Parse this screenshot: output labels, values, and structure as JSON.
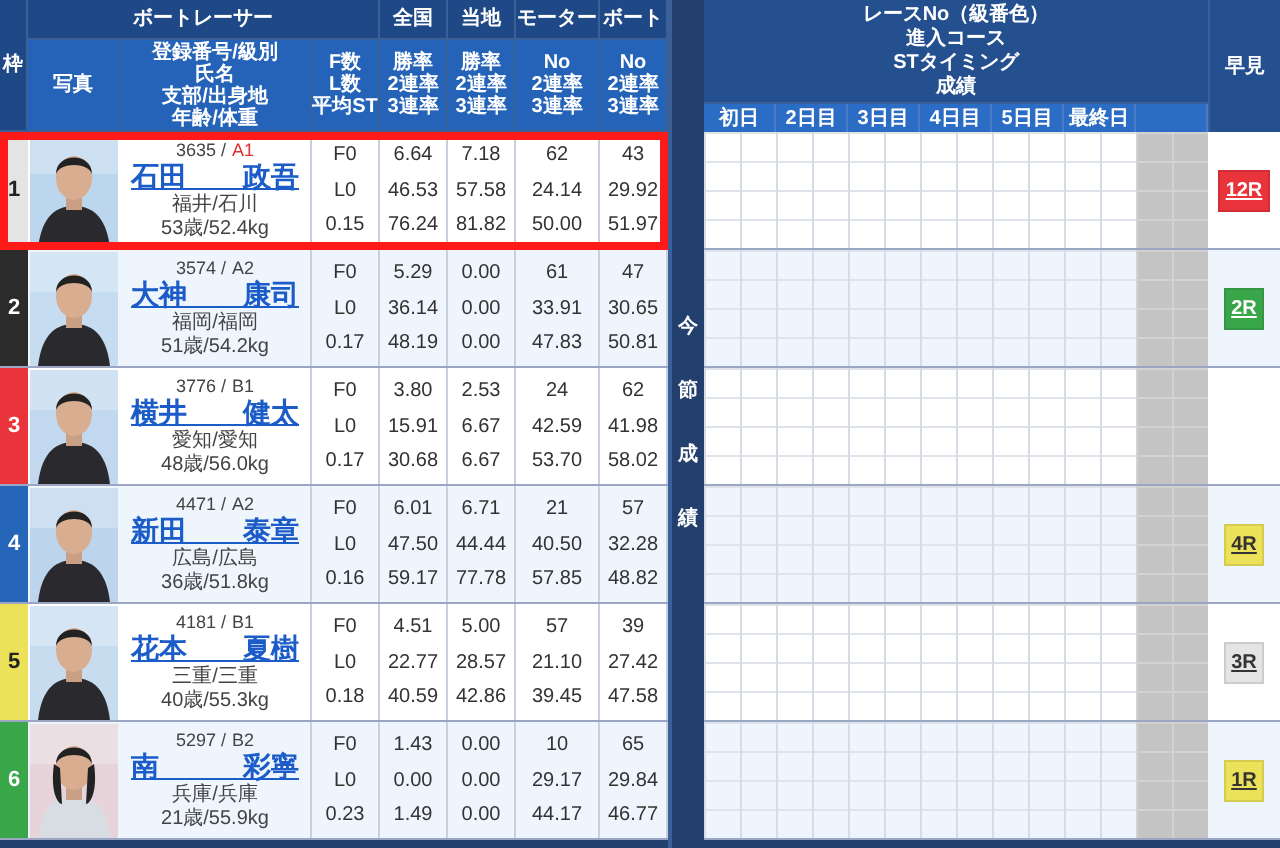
{
  "header": {
    "waku": "枠",
    "racer": "ボートレーサー",
    "groups": [
      "全国",
      "当地",
      "モーター",
      "ボート"
    ],
    "photo": "写真",
    "profile": [
      "登録番号/級別",
      "氏名",
      "支部/出身地",
      "年齢/体重"
    ],
    "fl": [
      "F数",
      "L数",
      "平均ST"
    ],
    "stats": [
      [
        "勝率",
        "2連率",
        "3連率"
      ],
      [
        "勝率",
        "2連率",
        "3連率"
      ],
      [
        "No",
        "2連率",
        "3連率"
      ],
      [
        "No",
        "2連率",
        "3連率"
      ]
    ]
  },
  "results_header": {
    "title": [
      "レースNo（級番色）",
      "進入コース",
      "STタイミング",
      "成績"
    ],
    "days": [
      "初日",
      "2日目",
      "3日目",
      "4日目",
      "5日目",
      "最終日"
    ],
    "quick": "早見"
  },
  "side_label": "今節成績",
  "racers": [
    {
      "frame": {
        "label": "1",
        "color": "#e4e4e4"
      },
      "highlighted": true,
      "number": "3635 /",
      "grade": {
        "label": "A1",
        "color": "#e03030"
      },
      "name": "石田　　政吾",
      "branch": "福井/石川",
      "age_weight": "53歳/52.4kg",
      "fl": [
        "F0",
        "L0",
        "0.15"
      ],
      "stats": [
        [
          "6.64",
          "46.53",
          "76.24"
        ],
        [
          "7.18",
          "57.58",
          "81.82"
        ],
        [
          "62",
          "24.14",
          "50.00"
        ],
        [
          "43",
          "29.92",
          "51.97"
        ]
      ],
      "quick": {
        "label": "12R",
        "color": "#e8343a"
      }
    },
    {
      "frame": {
        "label": "2",
        "color": "#2b2b2b"
      },
      "highlighted": false,
      "number": "3574 /",
      "grade": {
        "label": "A2",
        "color": "#444444"
      },
      "name": "大神　　康司",
      "branch": "福岡/福岡",
      "age_weight": "51歳/54.2kg",
      "fl": [
        "F0",
        "L0",
        "0.17"
      ],
      "stats": [
        [
          "5.29",
          "36.14",
          "48.19"
        ],
        [
          "0.00",
          "0.00",
          "0.00"
        ],
        [
          "61",
          "33.91",
          "47.83"
        ],
        [
          "47",
          "30.65",
          "50.81"
        ]
      ],
      "quick": {
        "label": "2R",
        "color": "#3aa64a"
      }
    },
    {
      "frame": {
        "label": "3",
        "color": "#e8343a"
      },
      "highlighted": false,
      "number": "3776 /",
      "grade": {
        "label": "B1",
        "color": "#444444"
      },
      "name": "横井　　健太",
      "branch": "愛知/愛知",
      "age_weight": "48歳/56.0kg",
      "fl": [
        "F0",
        "L0",
        "0.17"
      ],
      "stats": [
        [
          "3.80",
          "15.91",
          "30.68"
        ],
        [
          "2.53",
          "6.67",
          "6.67"
        ],
        [
          "24",
          "42.59",
          "53.70"
        ],
        [
          "62",
          "41.98",
          "58.02"
        ]
      ]
    },
    {
      "frame": {
        "label": "4",
        "color": "#2566b8"
      },
      "highlighted": false,
      "number": "4471 /",
      "grade": {
        "label": "A2",
        "color": "#444444"
      },
      "name": "新田　　泰章",
      "branch": "広島/広島",
      "age_weight": "36歳/51.8kg",
      "fl": [
        "F0",
        "L0",
        "0.16"
      ],
      "stats": [
        [
          "6.01",
          "47.50",
          "59.17"
        ],
        [
          "6.71",
          "44.44",
          "77.78"
        ],
        [
          "21",
          "40.50",
          "57.85"
        ],
        [
          "57",
          "32.28",
          "48.82"
        ]
      ],
      "quick": {
        "label": "4R",
        "color": "#ece25a"
      }
    },
    {
      "frame": {
        "label": "5",
        "color": "#ece25a"
      },
      "highlighted": false,
      "number": "4181 /",
      "grade": {
        "label": "B1",
        "color": "#444444"
      },
      "name": "花本　　夏樹",
      "branch": "三重/三重",
      "age_weight": "40歳/55.3kg",
      "fl": [
        "F0",
        "L0",
        "0.18"
      ],
      "stats": [
        [
          "4.51",
          "22.77",
          "40.59"
        ],
        [
          "5.00",
          "28.57",
          "42.86"
        ],
        [
          "57",
          "21.10",
          "39.45"
        ],
        [
          "39",
          "27.42",
          "47.58"
        ]
      ],
      "quick": {
        "label": "3R",
        "color": "#e4e4e4"
      }
    },
    {
      "frame": {
        "label": "6",
        "color": "#3aa64a"
      },
      "highlighted": false,
      "number": "5297 /",
      "grade": {
        "label": "B2",
        "color": "#444444"
      },
      "name": "南　　　彩寧",
      "branch": "兵庫/兵庫",
      "age_weight": "21歳/55.9kg",
      "fl": [
        "F0",
        "L0",
        "0.23"
      ],
      "stats": [
        [
          "1.43",
          "0.00",
          "1.49"
        ],
        [
          "0.00",
          "0.00",
          "0.00"
        ],
        [
          "10",
          "29.17",
          "44.17"
        ],
        [
          "65",
          "29.84",
          "46.77"
        ]
      ],
      "quick": {
        "label": "1R",
        "color": "#ece25a"
      }
    }
  ]
}
